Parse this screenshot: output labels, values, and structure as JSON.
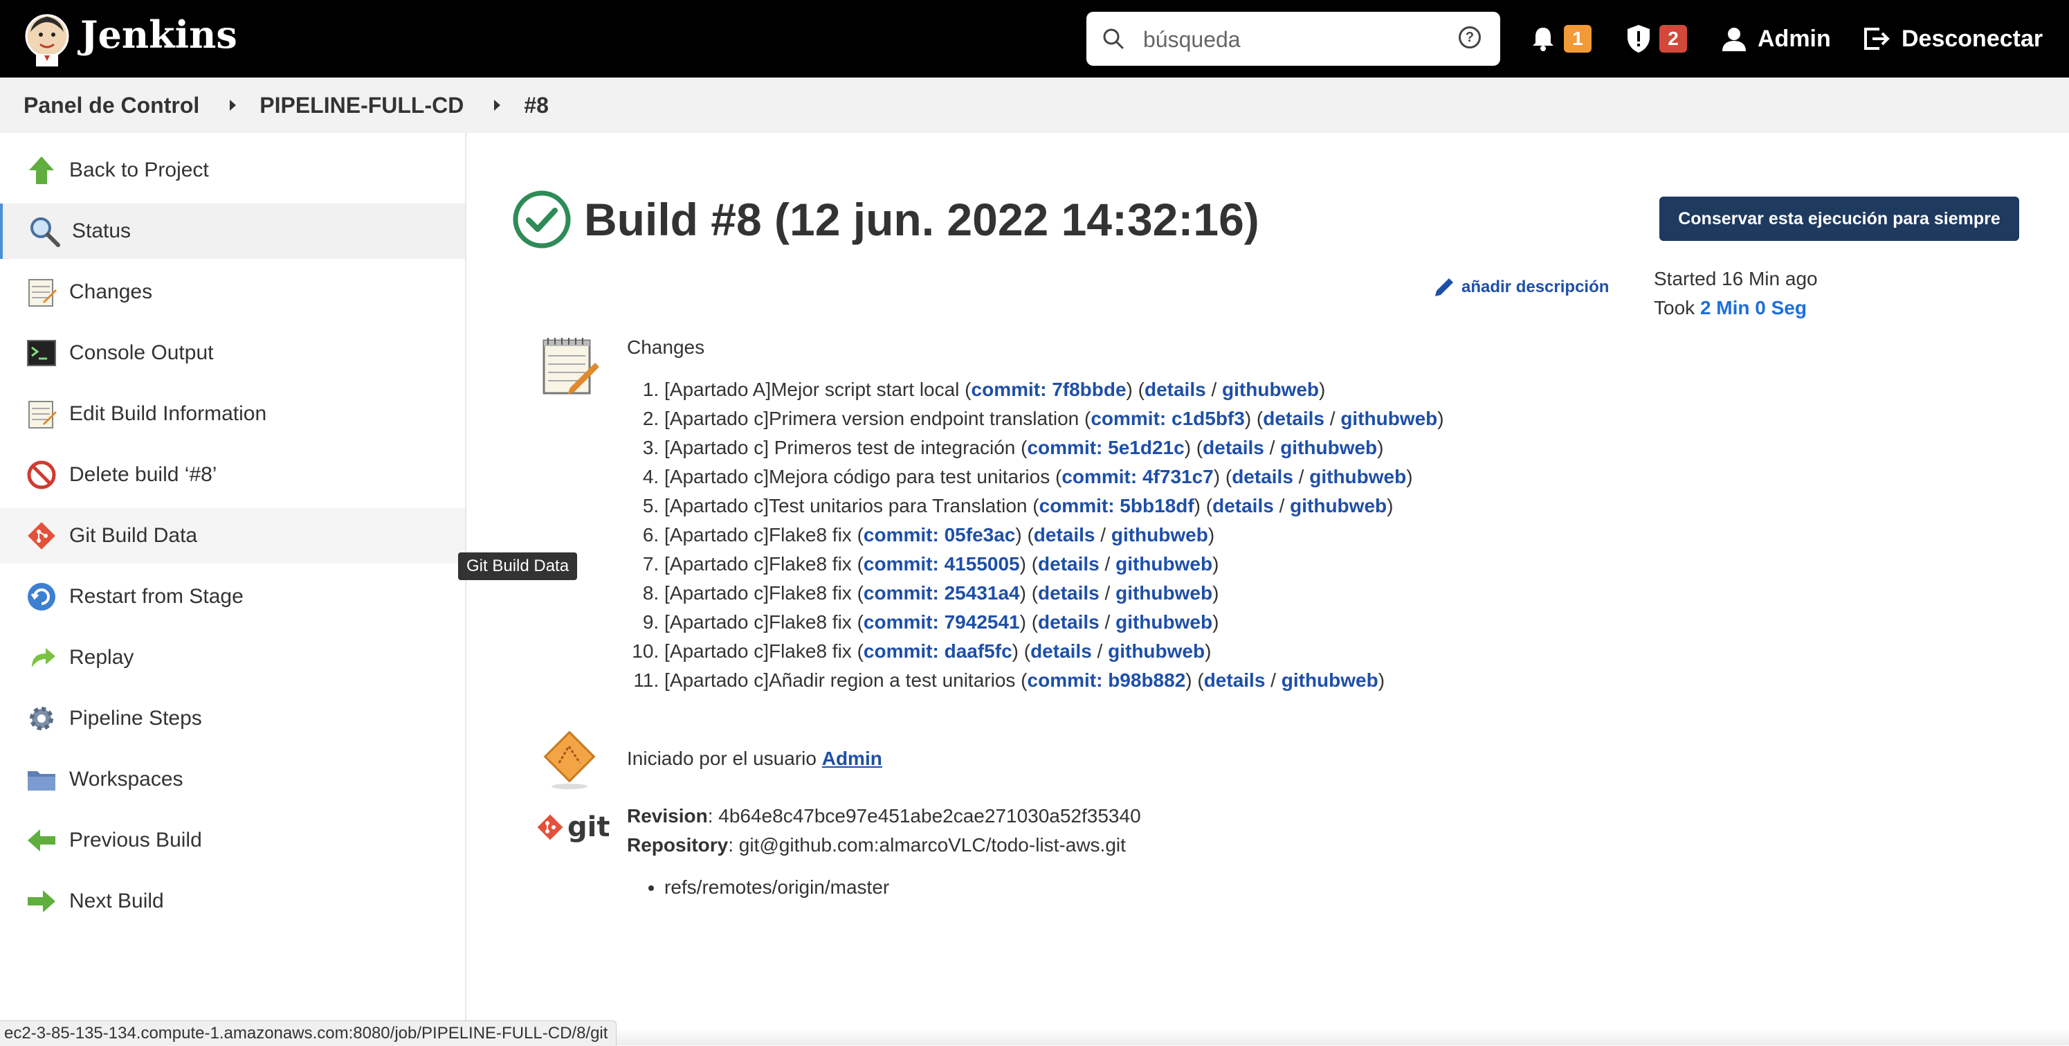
{
  "header": {
    "brand": "Jenkins",
    "search_placeholder": "búsqueda",
    "notifications_count": "1",
    "security_count": "2",
    "user": "Admin",
    "logout": "Desconectar"
  },
  "breadcrumb": [
    "Panel de Control",
    "PIPELINE-FULL-CD",
    "#8"
  ],
  "sidebar": {
    "items": [
      {
        "label": "Back to Project",
        "icon": "up-arrow-icon"
      },
      {
        "label": "Status",
        "icon": "magnifier-icon"
      },
      {
        "label": "Changes",
        "icon": "notepad-icon"
      },
      {
        "label": "Console Output",
        "icon": "terminal-icon"
      },
      {
        "label": "Edit Build Information",
        "icon": "notepad-icon"
      },
      {
        "label": "Delete build ‘#8’",
        "icon": "no-entry-icon"
      },
      {
        "label": "Git Build Data",
        "icon": "git-icon"
      },
      {
        "label": "Restart from Stage",
        "icon": "restart-icon"
      },
      {
        "label": "Replay",
        "icon": "replay-arrow-icon"
      },
      {
        "label": "Pipeline Steps",
        "icon": "gear-icon"
      },
      {
        "label": "Workspaces",
        "icon": "folder-icon"
      },
      {
        "label": "Previous Build",
        "icon": "left-arrow-icon"
      },
      {
        "label": "Next Build",
        "icon": "right-arrow-icon"
      }
    ],
    "tooltip": "Git Build Data"
  },
  "main": {
    "title": "Build #8 (12 jun. 2022 14:32:16)",
    "keep_button": "Conservar esta ejecución para siempre",
    "add_description": "añadir descripción",
    "started": "Started 16 Min ago",
    "took_label": "Took",
    "took_value": "2 Min 0 Seg",
    "changes_label": "Changes",
    "changes": [
      {
        "msg": "[Apartado A]Mejor script start local",
        "commit": "commit: 7f8bbde"
      },
      {
        "msg": "[Apartado c]Primera version endpoint translation",
        "commit": "commit: c1d5bf3"
      },
      {
        "msg": "[Apartado c] Primeros test de integración",
        "commit": "commit: 5e1d21c"
      },
      {
        "msg": "[Apartado c]Mejora código para test unitarios",
        "commit": "commit: 4f731c7"
      },
      {
        "msg": "[Apartado c]Test unitarios para Translation",
        "commit": "commit: 5bb18df"
      },
      {
        "msg": "[Apartado c]Flake8 fix",
        "commit": "commit: 05fe3ac"
      },
      {
        "msg": "[Apartado c]Flake8 fix",
        "commit": "commit: 4155005"
      },
      {
        "msg": "[Apartado c]Flake8 fix",
        "commit": "commit: 25431a4"
      },
      {
        "msg": "[Apartado c]Flake8 fix",
        "commit": "commit: 7942541"
      },
      {
        "msg": "[Apartado c]Flake8 fix",
        "commit": "commit: daaf5fc"
      },
      {
        "msg": "[Apartado c]Añadir region a test unitarios",
        "commit": "commit: b98b882"
      }
    ],
    "details_label": "details",
    "githubweb_label": "githubweb",
    "started_by_text": "Iniciado por el usuario",
    "started_by_user": "Admin",
    "git_logo_text": "git",
    "revision_label": "Revision",
    "revision_value": ": 4b64e8c47bce97e451abe2cae271030a52f35340",
    "repository_label": "Repository",
    "repository_value": ": git@github.com:almarcoVLC/todo-list-aws.git",
    "refs": [
      "refs/remotes/origin/master"
    ]
  },
  "statusbar_url": "ec2-3-85-135-134.compute-1.amazonaws.com:8080/job/PIPELINE-FULL-CD/8/git"
}
